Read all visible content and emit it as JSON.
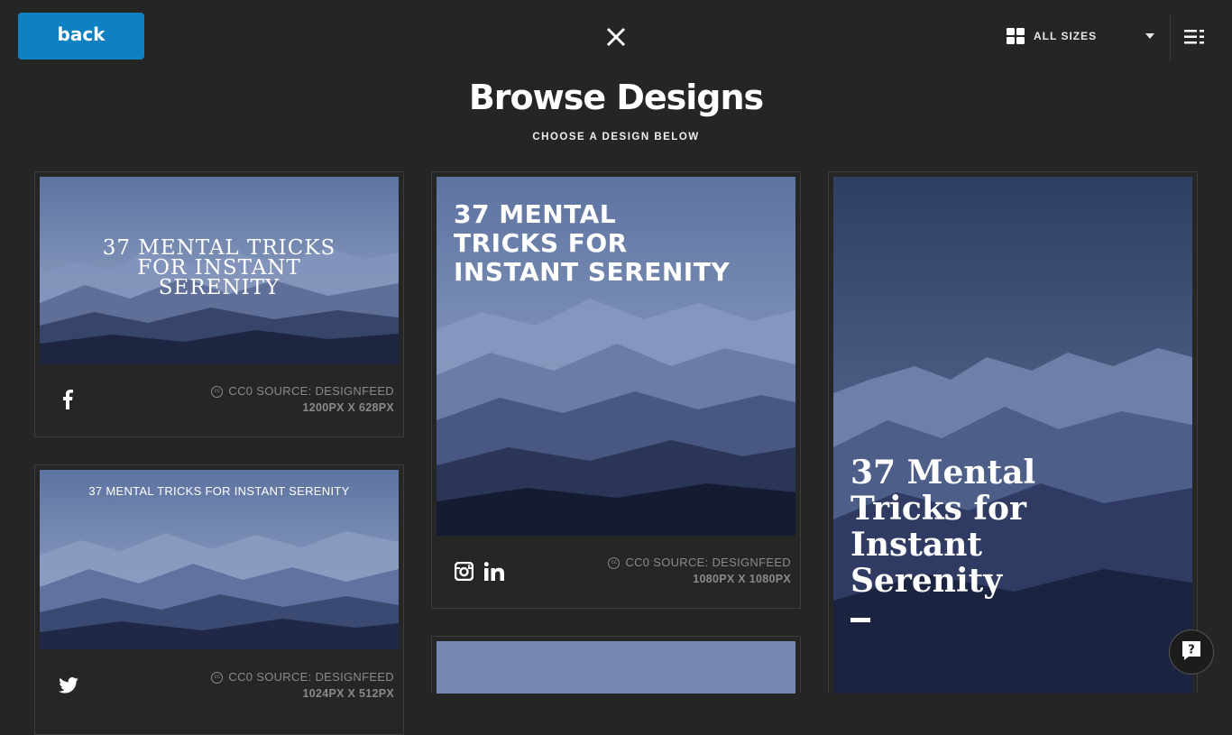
{
  "header": {
    "back_label": "back",
    "sizes_label": "ALL SIZES"
  },
  "page": {
    "title": "Browse Designs",
    "subtitle": "CHOOSE A DESIGN BELOW"
  },
  "designs": [
    {
      "text": [
        "37 MENTAL TRICKS",
        "FOR INSTANT",
        "SERENITY"
      ],
      "source": "CC0 SOURCE: DESIGNFEED",
      "size": "1200PX X 628PX",
      "platforms": [
        "facebook-icon"
      ]
    },
    {
      "text": [
        "37 MENTAL TRICKS FOR INSTANT SERENITY"
      ],
      "source": "CC0 SOURCE: DESIGNFEED",
      "size": "1024PX X 512PX",
      "platforms": [
        "twitter-icon"
      ]
    },
    {
      "text": [
        "37 MENTAL",
        "TRICKS FOR",
        "INSTANT SERENITY"
      ],
      "source": "CC0 SOURCE: DESIGNFEED",
      "size": "1080PX X 1080PX",
      "platforms": [
        "instagram-icon",
        "linkedin-icon"
      ]
    },
    {
      "text": [
        "37 Mental",
        "Tricks for",
        "Instant",
        "Serenity"
      ]
    }
  ],
  "colors": {
    "background": "#252525",
    "accent": "#0f80c1",
    "card_border": "#3d3d3d"
  }
}
